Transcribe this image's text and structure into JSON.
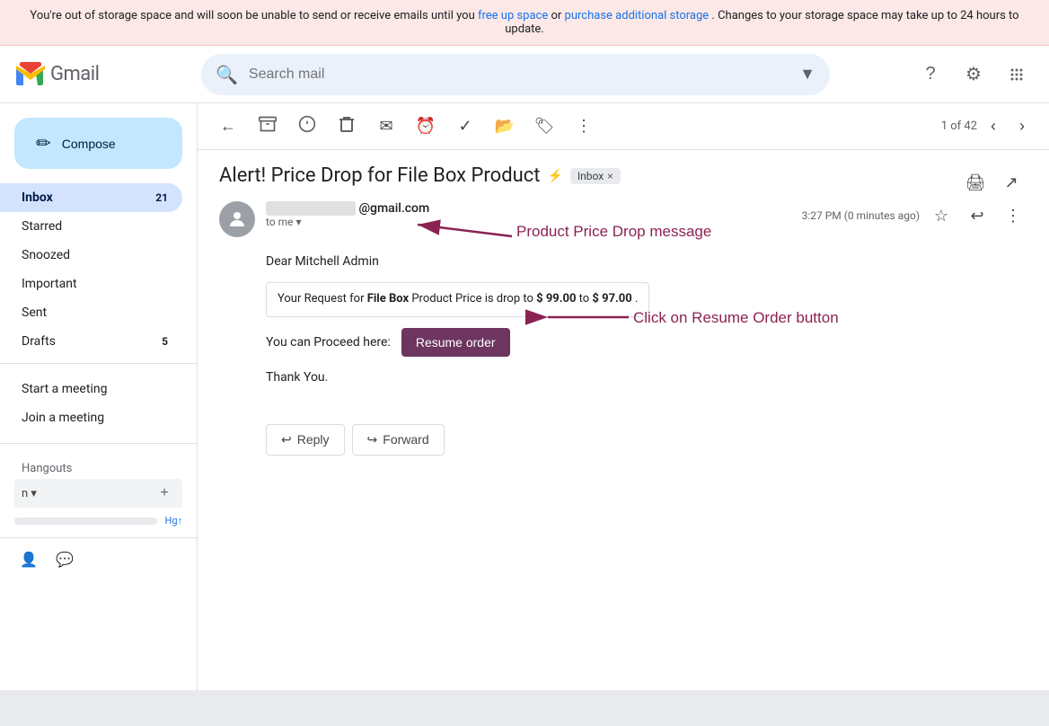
{
  "storage_banner": {
    "text_before": "You're out of storage space and will soon be unable to send or receive emails until you ",
    "link1_text": "free up space",
    "text_middle": " or ",
    "link2_text": "purchase additional storage",
    "text_after": ". Changes to your storage space may take up to 24 hours to update."
  },
  "header": {
    "logo_alt": "Gmail",
    "search_placeholder": "Search mail",
    "help_icon": "?",
    "settings_icon": "⚙",
    "apps_icon": "⋮⋮⋮"
  },
  "sidebar": {
    "compose_label": "Compose",
    "compose_icon": "✏",
    "nav_items": [
      {
        "id": "inbox",
        "label": "Inbox",
        "badge": "21",
        "active": true
      },
      {
        "id": "starred",
        "label": "Starred",
        "badge": "",
        "active": false
      },
      {
        "id": "snoozed",
        "label": "Snoozed",
        "badge": "",
        "active": false
      },
      {
        "id": "important",
        "label": "Important",
        "badge": "",
        "active": false
      },
      {
        "id": "sent",
        "label": "Sent",
        "badge": "",
        "active": false
      },
      {
        "id": "drafts",
        "label": "Drafts",
        "badge": "5",
        "active": false
      }
    ],
    "meet_items": [
      {
        "id": "start-meeting",
        "label": "Start a meeting"
      },
      {
        "id": "join-meeting",
        "label": "Join a meeting"
      }
    ],
    "hangouts_label": "Hangouts",
    "chat_placeholder": "n ▾",
    "add_icon": "+",
    "footer_icons": [
      "person",
      "chat-bubble"
    ]
  },
  "email": {
    "subject": "Alert! Price Drop for File Box Product",
    "subject_tag": "Inbox",
    "lightning": "⚡",
    "sender_email": "@gmail.com",
    "to": "to me",
    "timestamp": "3:27 PM (0 minutes ago)",
    "greeting": "Dear Mitchell Admin",
    "price_drop_box": {
      "before": "Your Request for ",
      "product": "File Box",
      "middle": " Product Price is drop to ",
      "price1": "$ 99.00",
      "to": " to ",
      "price2": "$ 97.00",
      "after": "."
    },
    "proceed_text": "You can Proceed here:",
    "resume_btn_label": "Resume order",
    "thank_you": "Thank You.",
    "reply_label": "Reply",
    "forward_label": "Forward",
    "pagination": "1 of 42",
    "annotation1": "Product Price Drop message",
    "annotation2": "Click on Resume Order button"
  },
  "toolbar": {
    "back_icon": "←",
    "archive_icon": "📁",
    "spam_icon": "⚠",
    "delete_icon": "🗑",
    "mark_icon": "✉",
    "snooze_icon": "⏰",
    "done_icon": "✓",
    "move_icon": "📂",
    "label_icon": "🏷",
    "more_icon": "⋮",
    "print_icon": "🖨",
    "open_icon": "↗"
  }
}
